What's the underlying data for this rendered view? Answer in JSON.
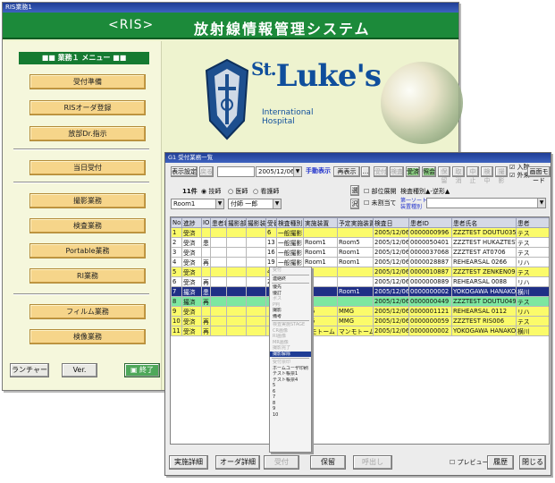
{
  "back_window": {
    "title": "RIS業務1",
    "banner_left": "<RIS>",
    "banner_title": "放射線情報管理システム",
    "menu_header": "■■ 業務１ メニュー ■■",
    "menu_group1": [
      "受付準備",
      "RISオーダ登録",
      "放部Dr.指示"
    ],
    "menu_group2": [
      "当日受付"
    ],
    "menu_group3": [
      "撮影業務",
      "検査業務",
      "Portable業務",
      "RI業務"
    ],
    "menu_group4": [
      "フィルム業務",
      "検像業務"
    ],
    "launcher_label": "ランチャー",
    "version_label": "Ver.",
    "exit_label": "終了",
    "logo": {
      "name_st": "St.",
      "name_lukes": "Luke's",
      "line1": "International",
      "line2": "Hospital"
    }
  },
  "front_window": {
    "title": "G1 受付業務一覧",
    "toolbar": {
      "settings_label": "表示設定",
      "back_label": "戻る",
      "date_value": "2005/12/06",
      "manual_display_label": "手動表示",
      "redisplay_label": "再表示",
      "top_buttons": [
        "受付",
        "検査",
        "受済",
        "照会",
        "保留",
        "取消",
        "中止",
        "検中",
        "撮影"
      ],
      "inpatient_label": "入院",
      "outpatient_label": "外来",
      "mode_label": "画面モード"
    },
    "filter": {
      "count_label": "11件",
      "radio_tech": "技師",
      "radio_doctor": "医師",
      "radio_nurse": "看護師",
      "room_value": "Room1",
      "attendant_value": "付師 一郎",
      "select_label1": "選",
      "select_label2": "沢",
      "check_region": "部位展開",
      "check_unassigned": "未割当て",
      "exam_type_label": "検査種別▲-逆形▲",
      "sort_label": "第一ソート",
      "sort_sub": "装置種別"
    },
    "table": {
      "headers": [
        "No.",
        "進捗",
        "IO",
        "患者状",
        "撮影部位",
        "撮影装置",
        "受番",
        "検査種別",
        "実施装置",
        "予定実施装置",
        "検査日",
        "患者ID",
        "患者氏名",
        "患者"
      ],
      "rows": [
        {
          "no": "1",
          "status": "受済",
          "io": "",
          "pstate": "",
          "part": "",
          "dev": "",
          "recv": "6",
          "type": "一般撮影",
          "exec": "",
          "plan": "",
          "date": "2005/12/06",
          "pid": "0000000996",
          "name": "ZZZTEST DOUTU035",
          "kana": "テス",
          "color": "yellow"
        },
        {
          "no": "2",
          "status": "受済",
          "io": "患",
          "pstate": "",
          "part": "",
          "dev": "",
          "recv": "13",
          "type": "一般撮影",
          "exec": "Room1",
          "plan": "Room5",
          "date": "2005/12/06",
          "pid": "0000050401",
          "name": "ZZZTEST HUKAZTEST041",
          "kana": "テス",
          "color": "white"
        },
        {
          "no": "3",
          "status": "受済",
          "io": "",
          "pstate": "",
          "part": "",
          "dev": "",
          "recv": "16",
          "type": "一般撮影",
          "exec": "Room1",
          "plan": "Room1",
          "date": "2005/12/06",
          "pid": "0000037068",
          "name": "ZZZTEST AT0706",
          "kana": "テス",
          "color": "white"
        },
        {
          "no": "4",
          "status": "受済",
          "io": "再",
          "pstate": "",
          "part": "",
          "dev": "",
          "recv": "19",
          "type": "一般撮影",
          "exec": "Room1",
          "plan": "Room1",
          "date": "2005/12/06",
          "pid": "0000028887",
          "name": "REHEARSAL 0266",
          "kana": "リハ",
          "color": "white"
        },
        {
          "no": "5",
          "status": "受済",
          "io": "",
          "pstate": "",
          "part": "",
          "dev": "",
          "recv": "4",
          "type": "一般撮影",
          "exec": "",
          "plan": "",
          "date": "2005/12/06",
          "pid": "0000010887",
          "name": "ZZZTEST ZENKEN096",
          "kana": "テス",
          "color": "yellow"
        },
        {
          "no": "6",
          "status": "受済",
          "io": "再",
          "pstate": "",
          "part": "",
          "dev": "",
          "recv": "24",
          "type": "一般撮影",
          "exec": "",
          "plan": "",
          "date": "2005/12/06",
          "pid": "0000000889",
          "name": "REHEARSAL 0088",
          "kana": "リハ",
          "color": "white"
        },
        {
          "no": "7",
          "status": "撮済",
          "io": "患",
          "pstate": "",
          "part": "",
          "dev": "",
          "recv": "",
          "type": "",
          "exec": "",
          "plan": "Room1",
          "date": "2005/12/06",
          "pid": "0000000002",
          "name": "YOKOGAWA HANAKO",
          "kana": "横川",
          "color": "sel"
        },
        {
          "no": "8",
          "status": "撮済",
          "io": "再",
          "pstate": "",
          "part": "",
          "dev": "",
          "recv": "",
          "type": "",
          "exec": "",
          "plan": "",
          "date": "2005/12/06",
          "pid": "0000000449",
          "name": "ZZZTEST DOUTU049",
          "kana": "テス",
          "color": "green"
        },
        {
          "no": "9",
          "status": "受済",
          "io": "",
          "pstate": "",
          "part": "",
          "dev": "",
          "recv": "",
          "type": "",
          "exec": "MG",
          "plan": "MMG",
          "date": "2005/12/06",
          "pid": "0000001121",
          "name": "REHEARSAL 0112",
          "kana": "リハ",
          "color": "yellow"
        },
        {
          "no": "10",
          "status": "受済",
          "io": "再",
          "pstate": "",
          "part": "",
          "dev": "",
          "recv": "",
          "type": "",
          "exec": "MG",
          "plan": "MMG",
          "date": "2005/12/06",
          "pid": "0000000059",
          "name": "ZZZTEST RIS006",
          "kana": "テス",
          "color": "yellow"
        },
        {
          "no": "11",
          "status": "受済",
          "io": "再",
          "pstate": "",
          "part": "",
          "dev": "",
          "recv": "",
          "type": "",
          "exec": "ンモトーム",
          "plan": "マンモトーム",
          "date": "2005/12/06",
          "pid": "0000000002",
          "name": "YOKOGAWA HANAKO",
          "kana": "横川",
          "color": "yellow"
        }
      ]
    },
    "context_menu": {
      "items": [
        {
          "label": "受付",
          "state": "dis"
        },
        {
          "label": "",
          "state": "sep"
        },
        {
          "label": "連絡終",
          "state": ""
        },
        {
          "label": "",
          "state": "sep"
        },
        {
          "label": "優先",
          "state": ""
        },
        {
          "label": "優訂",
          "state": ""
        },
        {
          "label": "ポス",
          "state": "dis"
        },
        {
          "label": "P判",
          "state": "dis"
        },
        {
          "label": "撮影",
          "state": ""
        },
        {
          "label": "備考",
          "state": ""
        },
        {
          "label": "",
          "state": "sep"
        },
        {
          "label": "検査実施STAGE",
          "state": "dis"
        },
        {
          "label": "CR画像",
          "state": "dis"
        },
        {
          "label": "RI画像",
          "state": "dis"
        },
        {
          "label": "MR画像",
          "state": "dis"
        },
        {
          "label": "撮影完了",
          "state": "dis"
        },
        {
          "label": "撮影解除",
          "state": "sel"
        },
        {
          "label": "",
          "state": "sep"
        },
        {
          "label": "受付票印",
          "state": "dis"
        },
        {
          "label": "ホームユーザ印刷",
          "state": ""
        },
        {
          "label": "テスト帳票1",
          "state": ""
        },
        {
          "label": "テスト帳票4",
          "state": ""
        },
        {
          "label": "5",
          "state": ""
        },
        {
          "label": "6",
          "state": ""
        },
        {
          "label": "7",
          "state": ""
        },
        {
          "label": "8",
          "state": ""
        },
        {
          "label": "9",
          "state": ""
        },
        {
          "label": "10",
          "state": ""
        }
      ]
    },
    "bottom": {
      "exec_detail": "実施詳細",
      "order_detail": "オーダ詳細",
      "accept": "受付",
      "hold": "保留",
      "recall": "呼出し",
      "preview": "プレビュー",
      "history": "履歴",
      "close": "閉じる"
    }
  }
}
